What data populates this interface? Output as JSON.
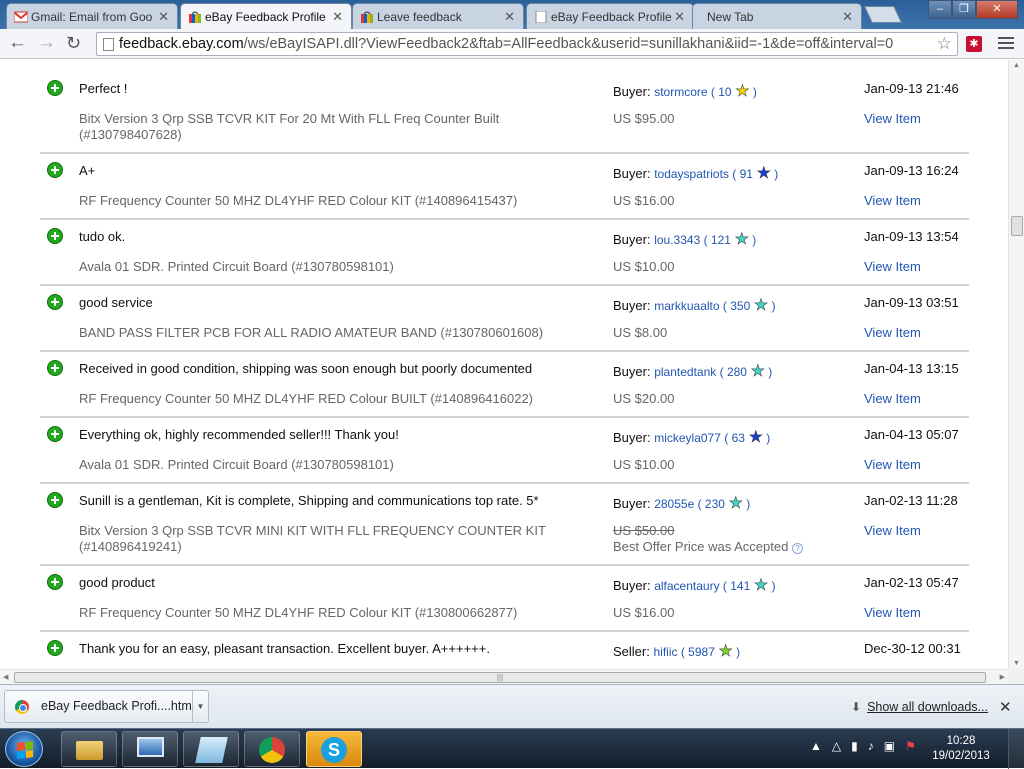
{
  "tabs": [
    {
      "title": "Gmail: Email from Goo",
      "favicon": "gmail-icon"
    },
    {
      "title": "eBay Feedback Profile",
      "favicon": "ebay-bag-icon",
      "active": true
    },
    {
      "title": "Leave feedback",
      "favicon": "ebay-bag-icon"
    },
    {
      "title": "eBay Feedback Profile",
      "favicon": "page-icon"
    },
    {
      "title": "New Tab",
      "favicon": ""
    }
  ],
  "toolbar": {
    "url_host": "feedback.ebay.com",
    "url_path": "/ws/eBayISAPI.dll?ViewFeedback2&ftab=AllFeedback&userid=sunillakhani&iid=-1&de=off&interval=0"
  },
  "feedback": [
    {
      "comment": "Perfect !",
      "role": "Buyer:",
      "user": "stormcore",
      "score": "10",
      "star": "#f0d800",
      "item": "Bitx Version 3 Qrp SSB TCVR KIT For 20 Mt With FLL Freq Counter Built (#130798407628)",
      "price": "US $95.00",
      "date": "Jan-09-13 21:46",
      "view": "View Item"
    },
    {
      "comment": "A+",
      "role": "Buyer:",
      "user": "todayspatriots",
      "score": "91",
      "star": "#1b3fcf",
      "item": "RF Frequency Counter 50 MHZ DL4YHF RED Colour KIT (#140896415437)",
      "price": "US $16.00",
      "date": "Jan-09-13 16:24",
      "view": "View Item"
    },
    {
      "comment": "tudo ok.",
      "role": "Buyer:",
      "user": "lou.3343",
      "score": "121",
      "star": "#3fd3c3",
      "item": "Avala 01 SDR. Printed Circuit Board (#130780598101)",
      "price": "US $10.00",
      "date": "Jan-09-13 13:54",
      "view": "View Item"
    },
    {
      "comment": "good service",
      "role": "Buyer:",
      "user": "markkuaalto",
      "score": "350",
      "star": "#3fd3c3",
      "item": "BAND PASS FILTER PCB FOR ALL RADIO AMATEUR BAND (#130780601608)",
      "price": "US $8.00",
      "date": "Jan-09-13 03:51",
      "view": "View Item"
    },
    {
      "comment": "Received in good condition, shipping was soon enough but poorly documented",
      "role": "Buyer:",
      "user": "plantedtank",
      "score": "280",
      "star": "#3fd3c3",
      "item": "RF Frequency Counter 50 MHZ DL4YHF RED Colour BUILT (#140896416022)",
      "price": "US $20.00",
      "date": "Jan-04-13 13:15",
      "view": "View Item"
    },
    {
      "comment": "Everything ok, highly recommended seller!!! Thank you!",
      "role": "Buyer:",
      "user": "mickeyla077",
      "score": "63",
      "star": "#1b3fcf",
      "item": "Avala 01 SDR. Printed Circuit Board (#130780598101)",
      "price": "US $10.00",
      "date": "Jan-04-13 05:07",
      "view": "View Item"
    },
    {
      "comment": "Sunill is a gentleman, Kit is complete, Shipping and communications top rate. 5*",
      "role": "Buyer:",
      "user": "28055e",
      "score": "230",
      "star": "#3fd3c3",
      "item": "Bitx Version 3 Qrp SSB TCVR MINI KIT WITH FLL FREQUENCY COUNTER KIT (#140896419241)",
      "price": "US $50.00",
      "price_strike": true,
      "best_offer": "Best Offer Price was Accepted",
      "date": "Jan-02-13 11:28",
      "view": "View Item"
    },
    {
      "comment": "good product",
      "role": "Buyer:",
      "user": "alfacentaury",
      "score": "141",
      "star": "#3fd3c3",
      "item": "RF Frequency Counter 50 MHZ DL4YHF RED Colour KIT (#130800662877)",
      "price": "US $16.00",
      "date": "Jan-02-13 05:47",
      "view": "View Item"
    },
    {
      "comment": "Thank you for an easy, pleasant transaction. Excellent buyer. A++++++.",
      "role": "Seller:",
      "user": "hifiic",
      "score": "5987",
      "star": "#7ed321",
      "item": "",
      "price": "",
      "date": "Dec-30-12 00:31",
      "view": ""
    }
  ],
  "download": {
    "file": "eBay Feedback Profi....htm",
    "show_all": "Show all downloads..."
  },
  "clock": {
    "time": "10:28",
    "date": "19/02/2013"
  }
}
